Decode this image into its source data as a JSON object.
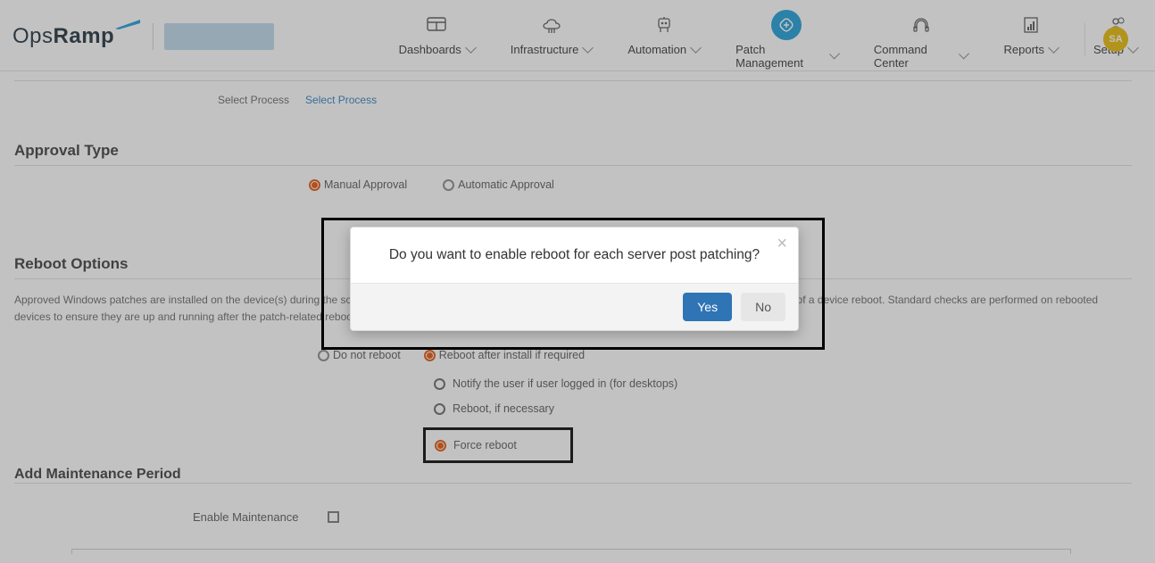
{
  "brand": {
    "part1": "Ops",
    "part2": "Ramp"
  },
  "nav": {
    "items": [
      {
        "label": "Dashboards"
      },
      {
        "label": "Infrastructure"
      },
      {
        "label": "Automation"
      },
      {
        "label": "Patch Management"
      },
      {
        "label": "Command Center"
      },
      {
        "label": "Reports"
      },
      {
        "label": "Setup"
      }
    ]
  },
  "avatar": "SA",
  "process": {
    "label": "Select Process",
    "link": "Select Process"
  },
  "sections": {
    "approval": {
      "title": "Approval Type",
      "manual": "Manual Approval",
      "automatic": "Automatic Approval"
    },
    "reboot": {
      "title": "Reboot Options",
      "desc": "Approved Windows patches are installed on the device(s) during the scheduled maintenance window. If you have enabled the reboot option, anticipate the possibility of a device reboot. Standard checks are performed on rebooted devices to ensure they are up and running after the patch-related reboot.",
      "opt_no": "Do not reboot",
      "opt_after": "Reboot after install if required",
      "sub_notify": "Notify the user if user logged in (for desktops)",
      "sub_necessary": "Reboot, if necessary",
      "sub_force": "Force reboot"
    },
    "maintenance": {
      "title": "Add Maintenance Period",
      "enable": "Enable Maintenance"
    }
  },
  "modal": {
    "message": "Do you want to enable reboot for each server post patching?",
    "yes": "Yes",
    "no": "No",
    "close": "×"
  }
}
